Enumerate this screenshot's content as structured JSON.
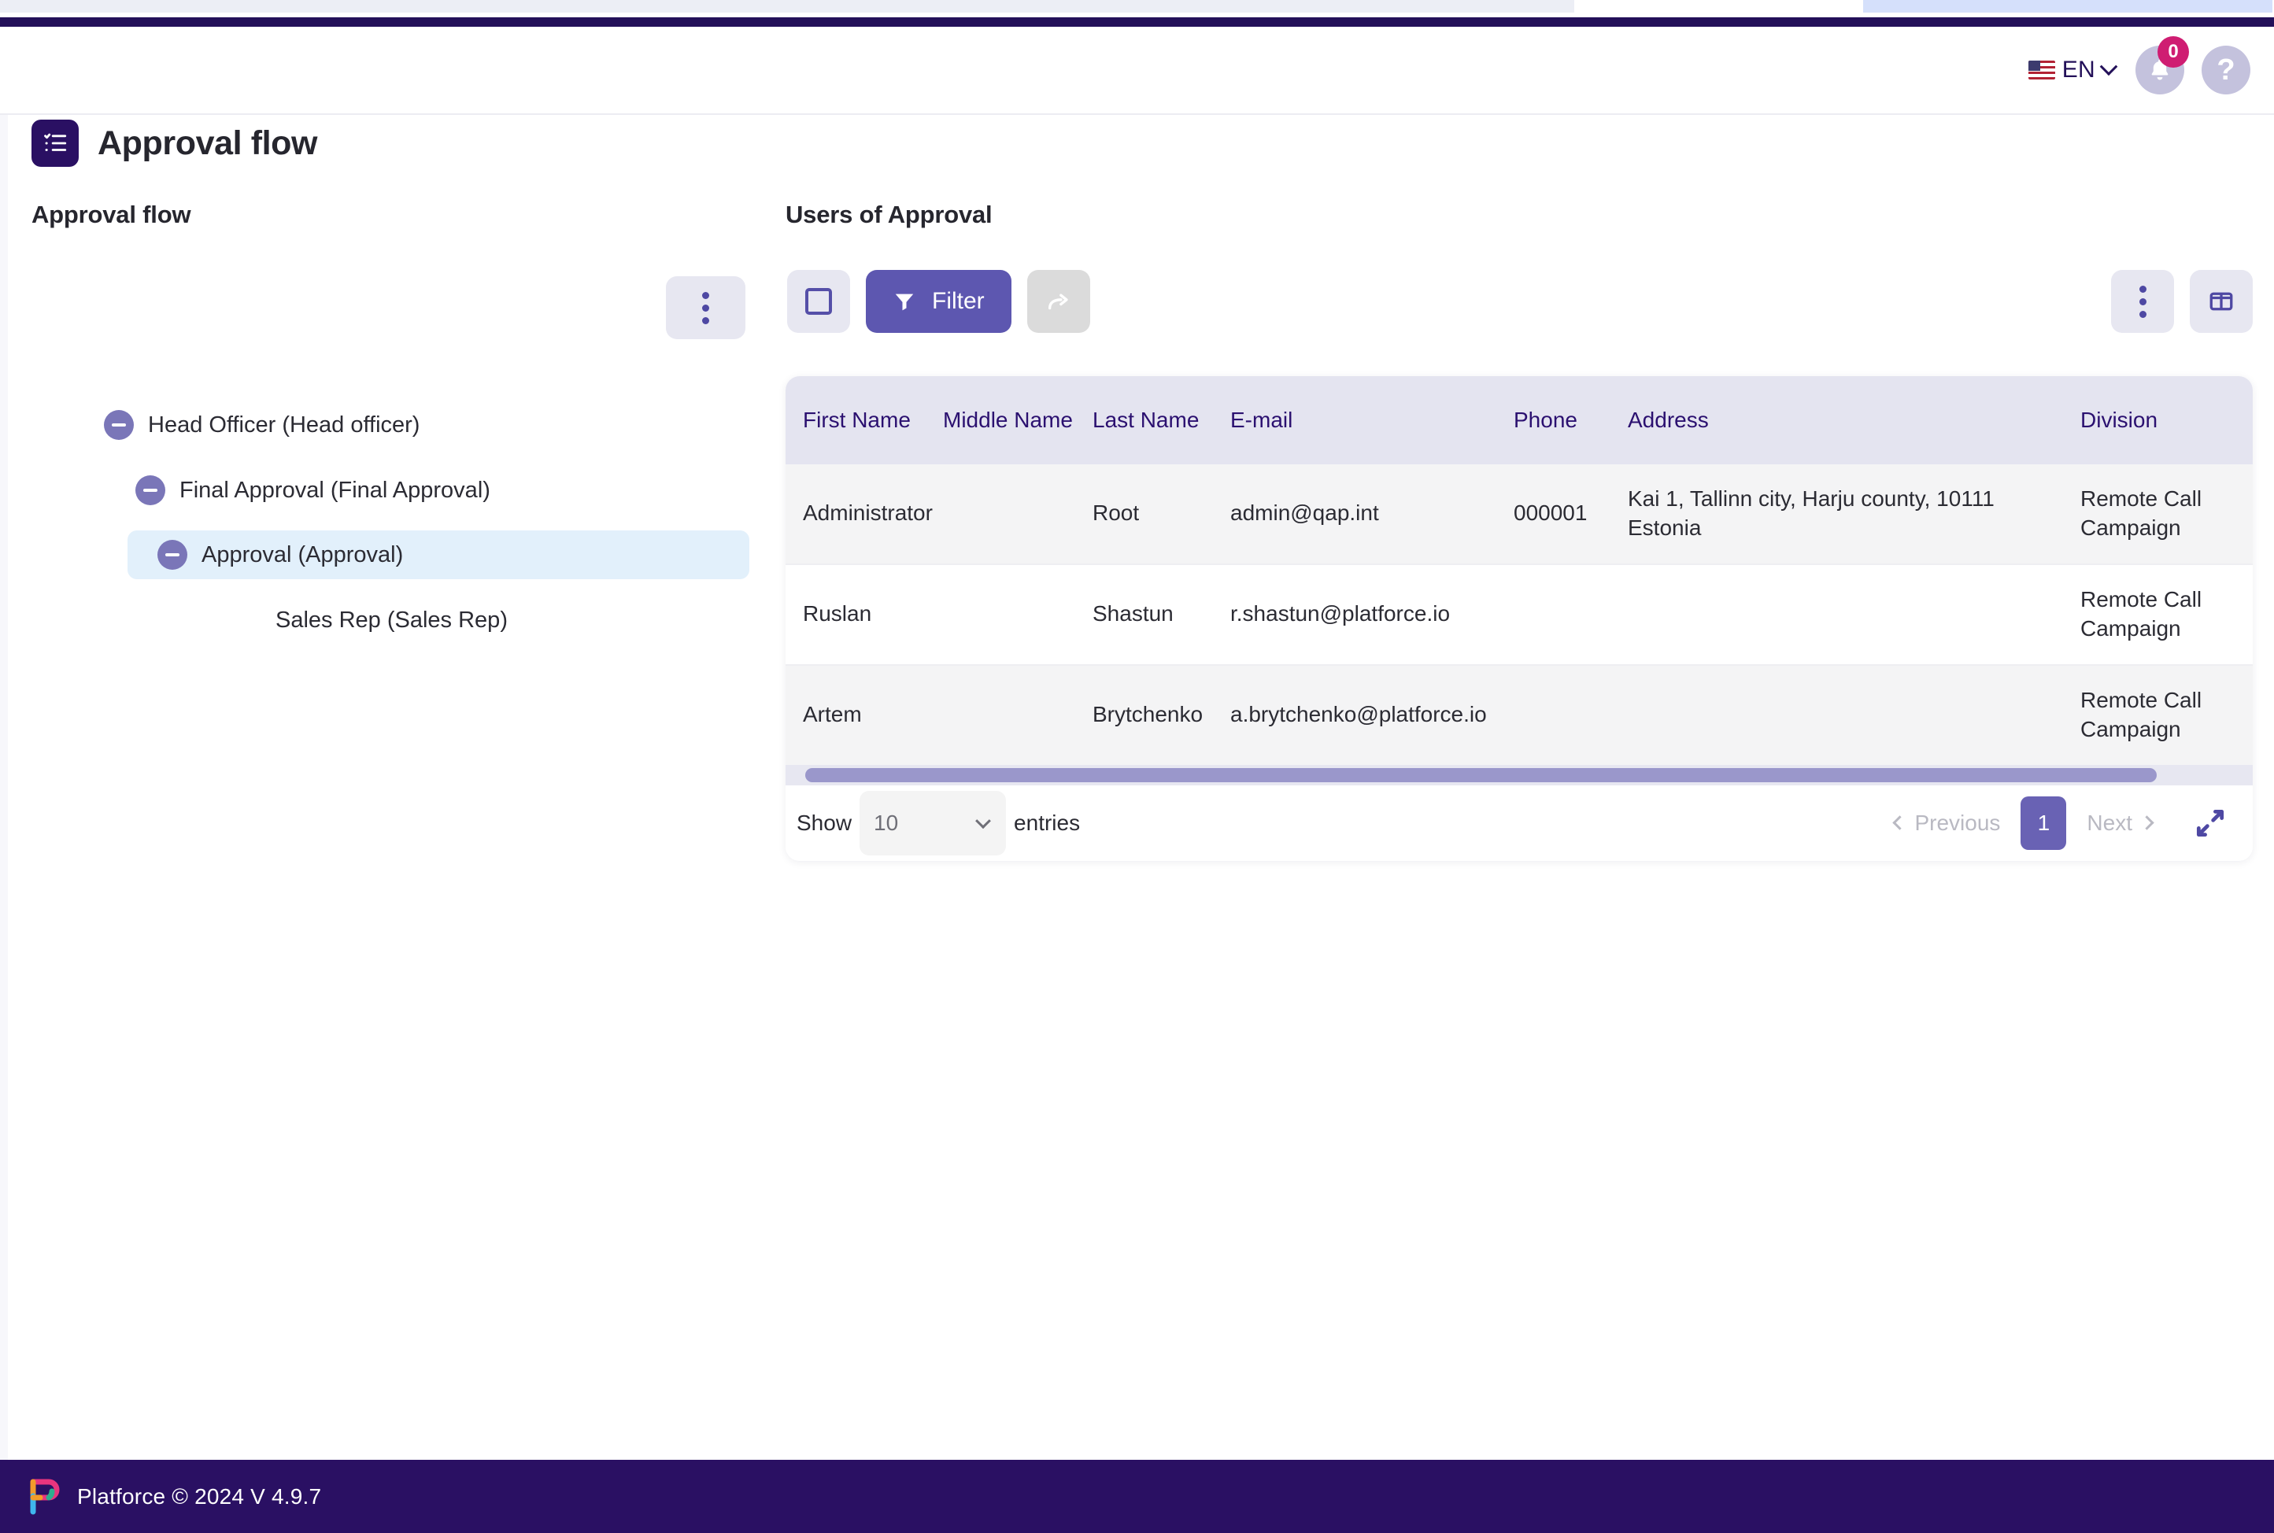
{
  "header": {
    "language_label": "EN",
    "flag_icon": "us-flag-icon",
    "notifications_badge": "0",
    "notifications_icon": "bell-icon",
    "help_icon": "question-mark-icon"
  },
  "page": {
    "title": "Approval flow",
    "title_icon": "checklist-icon"
  },
  "left_panel": {
    "heading": "Approval flow",
    "menu_icon": "vertical-dots-icon",
    "tree": [
      {
        "label": "Head Officer (Head officer)",
        "level": 1,
        "has_toggle": true,
        "selected": false
      },
      {
        "label": "Final Approval (Final Approval)",
        "level": 2,
        "has_toggle": true,
        "selected": false
      },
      {
        "label": "Approval (Approval)",
        "level": 3,
        "has_toggle": true,
        "selected": true
      },
      {
        "label": "Sales Rep (Sales Rep)",
        "level": 4,
        "has_toggle": false,
        "selected": false
      }
    ]
  },
  "right_panel": {
    "heading": "Users of Approval",
    "toolbar": {
      "select_icon": "checkbox-square-icon",
      "filter_label": "Filter",
      "filter_icon": "funnel-icon",
      "share_icon": "forward-arrow-icon",
      "menu_icon": "vertical-dots-icon",
      "columns_icon": "columns-layout-icon"
    },
    "table": {
      "columns": [
        "First Name",
        "Middle Name",
        "Last Name",
        "E-mail",
        "Phone",
        "Address",
        "Division"
      ],
      "rows": [
        {
          "first_name": "Administrator",
          "middle_name": "",
          "last_name": "Root",
          "email": "admin@qap.int",
          "phone": "000001",
          "address": "Kai 1, Tallinn city, Harju county, 10111 Estonia",
          "division": "Remote Call Campaign"
        },
        {
          "first_name": "Ruslan",
          "middle_name": "",
          "last_name": "Shastun",
          "email": "r.shastun@platforce.io",
          "phone": "",
          "address": "",
          "division": "Remote Call Campaign"
        },
        {
          "first_name": "Artem",
          "middle_name": "",
          "last_name": "Brytchenko",
          "email": "a.brytchenko@platforce.io",
          "phone": "",
          "address": "",
          "division": "Remote Call Campaign"
        }
      ]
    },
    "footer": {
      "show_label": "Show",
      "entries_value": "10",
      "entries_label": "entries",
      "previous_label": "Previous",
      "current_page": "1",
      "next_label": "Next",
      "expand_icon": "expand-arrows-icon"
    }
  },
  "app_footer": {
    "text": "Platforce © 2024 V 4.9.7",
    "logo_icon": "platforce-logo-icon"
  },
  "colors": {
    "brand_dark": "#2a1063",
    "accent_purple": "#5d57b0",
    "badge_pink": "#cf1d72",
    "header_navy": "#231059",
    "table_header_bg": "#e4e4f0",
    "selected_row_bg": "#e2f0fb"
  }
}
